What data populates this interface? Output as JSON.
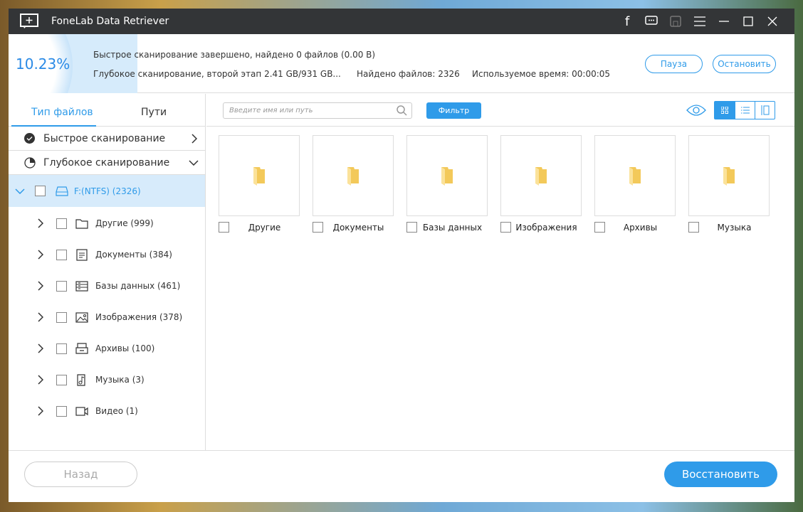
{
  "app": {
    "title": "FoneLab Data Retriever"
  },
  "progress": {
    "percent_label": "10.23%",
    "value": 10.23
  },
  "status": {
    "quick": "Быстрое сканирование завершено, найдено 0 файлов (0.00  B)",
    "deep": "Глубокое сканирование, второй этап 2.41 GB/931 GB...",
    "found": "Найдено файлов: 2326",
    "time": "Используемое время: 00:00:05"
  },
  "buttons": {
    "pause": "Пауза",
    "stop": "Остановить",
    "filter": "Фильтр",
    "back": "Назад",
    "restore": "Восстановить"
  },
  "tabs": [
    {
      "label": "Тип файлов",
      "active": true
    },
    {
      "label": "Пути",
      "active": false
    }
  ],
  "sidebar": {
    "quick": "Быстрое сканирование",
    "deep": "Глубокое сканирование",
    "drive": "F:(NTFS) (2326)",
    "items": [
      {
        "label": "Другие (999)",
        "icon": "folder-icon"
      },
      {
        "label": "Документы (384)",
        "icon": "document-icon"
      },
      {
        "label": "Базы данных (461)",
        "icon": "database-icon"
      },
      {
        "label": "Изображения (378)",
        "icon": "image-icon"
      },
      {
        "label": "Архивы (100)",
        "icon": "archive-icon"
      },
      {
        "label": "Музыка (3)",
        "icon": "music-icon"
      },
      {
        "label": "Видео (1)",
        "icon": "video-icon"
      }
    ]
  },
  "search": {
    "placeholder": "Введите имя или путь"
  },
  "grid": [
    "Другие",
    "Документы",
    "Базы данных",
    "Изображения",
    "Архивы",
    "Музыка"
  ],
  "colors": {
    "accent": "#2f9be9",
    "titlebar": "#333537",
    "selected": "#d7ebfb"
  }
}
